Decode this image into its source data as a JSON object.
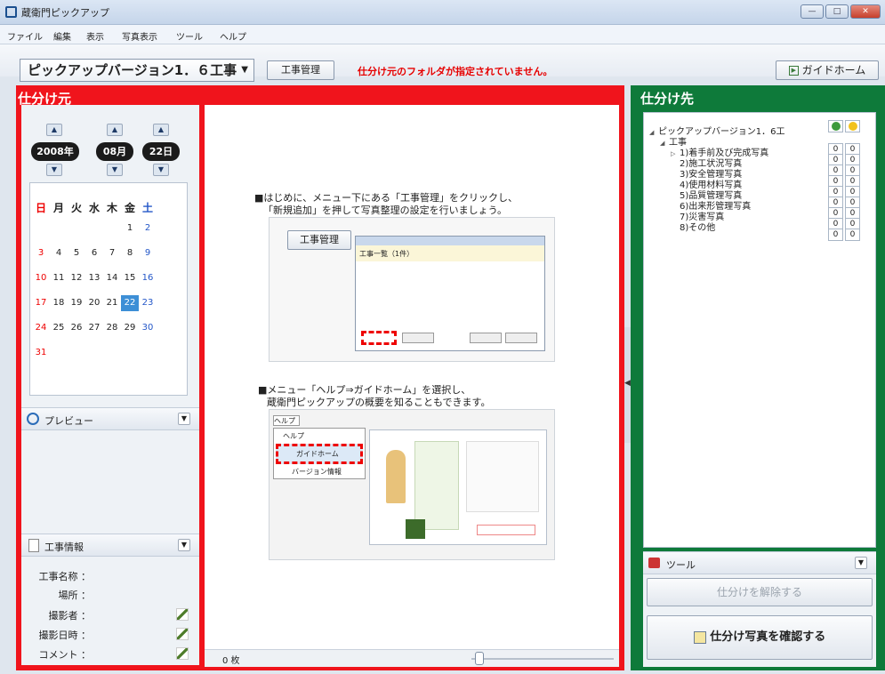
{
  "window": {
    "title": "蔵衛門ピックアップ",
    "buttons": [
      "—",
      "□",
      "✕"
    ]
  },
  "menu": [
    "ファイル",
    "編集",
    "表示",
    "写真表示",
    "ツール",
    "ヘルプ"
  ],
  "toolbar": {
    "version_select": "ピックアップバージョン1．６工事",
    "manage_button": "工事管理",
    "warning": "仕分け元のフォルダが指定されていません。",
    "guide_home_button": "ガイドホーム"
  },
  "source_panel": {
    "title": "仕分け元",
    "date": {
      "year": "2008年",
      "month": "08月",
      "day": "22日"
    },
    "calendar": {
      "weekdays": [
        "日",
        "月",
        "火",
        "水",
        "木",
        "金",
        "土"
      ],
      "weeks": [
        [
          "",
          "",
          "",
          "",
          "",
          "1",
          "2"
        ],
        [
          "3",
          "4",
          "5",
          "6",
          "7",
          "8",
          "9"
        ],
        [
          "10",
          "11",
          "12",
          "13",
          "14",
          "15",
          "16"
        ],
        [
          "17",
          "18",
          "19",
          "20",
          "21",
          "22",
          "23"
        ],
        [
          "24",
          "25",
          "26",
          "27",
          "28",
          "29",
          "30"
        ],
        [
          "31",
          "",
          "",
          "",
          "",
          "",
          ""
        ]
      ],
      "selected": "22"
    },
    "preview_label": "プレビュー",
    "project_info_label": "工事情報",
    "fields": [
      "工事名称 ：",
      "場所 ：",
      "撮影者 ：",
      "撮影日時 ：",
      "コメント ："
    ],
    "photo_count": "0 枚"
  },
  "guide": {
    "step1_line1": "■はじめに、メニュー下にある「工事管理」をクリックし、",
    "step1_line2": "「新規追加」を押して写真整理の設定を行いましょう。",
    "step1_button": "工事管理",
    "step1_dialog_text": "工事一覧（1件）",
    "step2_line1": "■メニュー「ヘルプ⇒ガイドホーム」を選択し、",
    "step2_line2": "蔵衛門ピックアップの概要を知ることもできます。",
    "step2_menu": [
      "ヘルプ",
      "ヘルプ",
      "ガイドホーム",
      "バージョン情報"
    ]
  },
  "dest_panel": {
    "title": "仕分け先",
    "tree": [
      {
        "label": "ピックアップバージョン1．6工",
        "level": 0,
        "expander": "◢",
        "counts": null
      },
      {
        "label": "工事",
        "level": 1,
        "expander": "◢",
        "counts": [
          "0",
          "0"
        ]
      },
      {
        "label": "1)着手前及び完成写真",
        "level": 2,
        "expander": "▷",
        "counts": [
          "0",
          "0"
        ]
      },
      {
        "label": "2)施工状況写真",
        "level": 2,
        "expander": "",
        "counts": [
          "0",
          "0"
        ]
      },
      {
        "label": "3)安全管理写真",
        "level": 2,
        "expander": "",
        "counts": [
          "0",
          "0"
        ]
      },
      {
        "label": "4)使用材料写真",
        "level": 2,
        "expander": "",
        "counts": [
          "0",
          "0"
        ]
      },
      {
        "label": "5)品質管理写真",
        "level": 2,
        "expander": "",
        "counts": [
          "0",
          "0"
        ]
      },
      {
        "label": "6)出来形管理写真",
        "level": 2,
        "expander": "",
        "counts": [
          "0",
          "0"
        ]
      },
      {
        "label": "7)災害写真",
        "level": 2,
        "expander": "",
        "counts": [
          "0",
          "0"
        ]
      },
      {
        "label": "8)その他",
        "level": 2,
        "expander": "",
        "counts": [
          "0",
          "0"
        ]
      }
    ],
    "tools_label": "ツール",
    "unassign_button": "仕分けを解除する",
    "confirm_button": "仕分け写真を確認する"
  },
  "colors": {
    "source_accent": "#f0141c",
    "dest_accent": "#0e7a3a",
    "selected_day": "#3d8fd6"
  }
}
